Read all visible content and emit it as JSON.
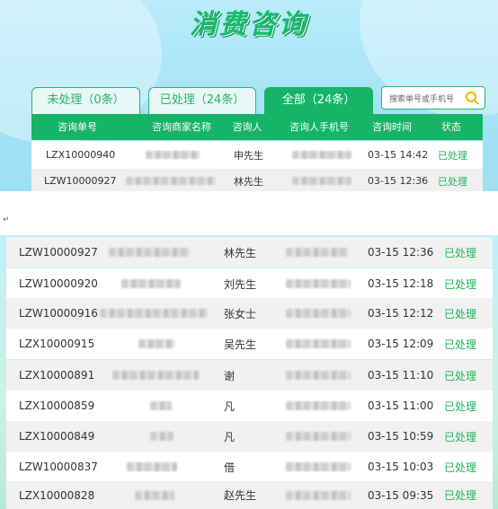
{
  "header": {
    "title": "消费咨询"
  },
  "tabs": [
    {
      "label": "未处理（0条）",
      "active": false
    },
    {
      "label": "已处理（24条）",
      "active": false
    },
    {
      "label": "全部（24条）",
      "active": true
    }
  ],
  "search": {
    "placeholder": "搜索单号或手机号",
    "icon": "search-icon"
  },
  "table": {
    "headers": [
      "咨询单号",
      "咨询商家名称",
      "咨询人",
      "咨询人手机号",
      "咨询时间",
      "状态"
    ]
  },
  "preview_rows": [
    {
      "id": "LZX10000940",
      "merchant": "",
      "person": "申先生",
      "phone": "",
      "time": "03-15 14:42",
      "status": "已处理"
    },
    {
      "id": "LZW10000927",
      "merchant": "",
      "person": "林先生",
      "phone": "",
      "time": "03-15 12:36",
      "status": "已处理"
    }
  ],
  "marker": "↵",
  "rows": [
    {
      "id": "LZW10000927",
      "merchant": "",
      "person": "林先生",
      "phone": "",
      "time": "03-15 12:36",
      "status": "已处理"
    },
    {
      "id": "LZW10000920",
      "merchant": "",
      "person": "刘先生",
      "phone": "",
      "time": "03-15 12:18",
      "status": "已处理"
    },
    {
      "id": "LZW10000916",
      "merchant": "",
      "person": "张女士",
      "phone": "",
      "time": "03-15 12:12",
      "status": "已处理"
    },
    {
      "id": "LZX10000915",
      "merchant": "",
      "person": "吴先生",
      "phone": "",
      "time": "03-15 12:09",
      "status": "已处理"
    },
    {
      "id": "LZX10000891",
      "merchant": "",
      "person": "谢",
      "phone": "",
      "time": "03-15 11:10",
      "status": "已处理"
    },
    {
      "id": "LZX10000859",
      "merchant": "",
      "person": "凡",
      "phone": "",
      "time": "03-15 11:00",
      "status": "已处理"
    },
    {
      "id": "LZX10000849",
      "merchant": "",
      "person": "凡",
      "phone": "",
      "time": "03-15 10:59",
      "status": "已处理"
    },
    {
      "id": "LZW10000837",
      "merchant": "",
      "person": "借",
      "phone": "",
      "time": "03-15 10:03",
      "status": "已处理"
    },
    {
      "id": "LZX10000828",
      "merchant": "",
      "person": "赵先生",
      "phone": "",
      "time": "03-15 09:35",
      "status": "已处理"
    }
  ],
  "colors": {
    "brand_green": "#15b467",
    "status_green": "#1fb35a",
    "sky": "#a4e2f6"
  }
}
